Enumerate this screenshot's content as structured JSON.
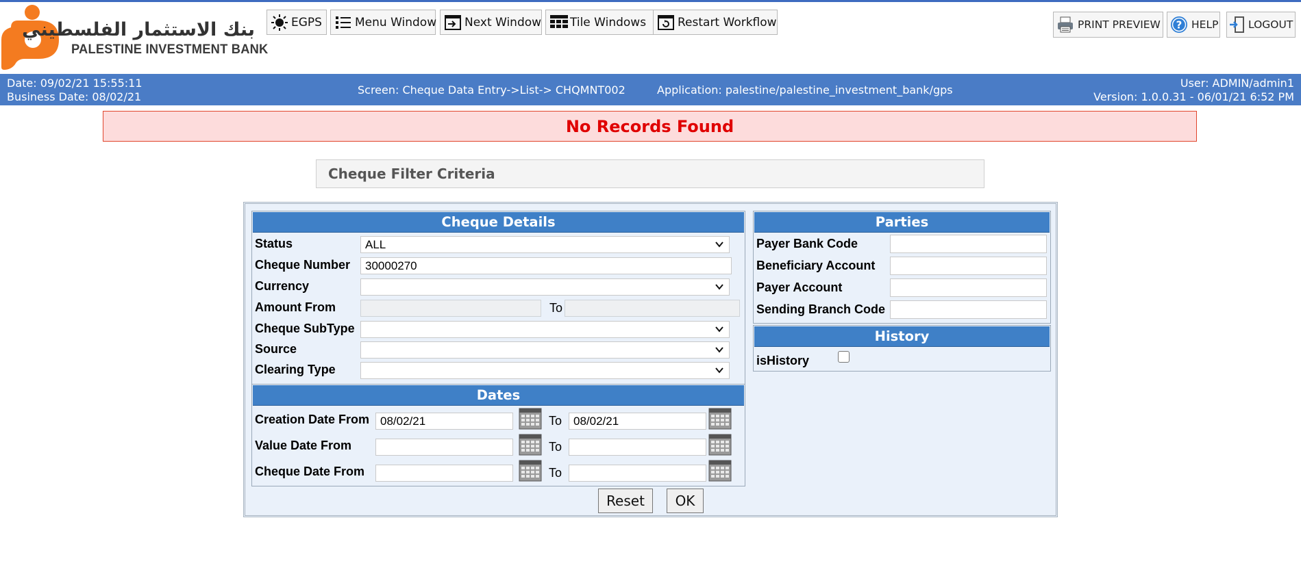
{
  "logo": {
    "arabic_name": "بنك الاستثمار الفلسطيني",
    "english_name": "PALESTINE INVESTMENT BANK",
    "brand_color": "#f47b20"
  },
  "toolbar": {
    "egps": "EGPS",
    "menu_window": "Menu Window",
    "next_window": "Next Window",
    "tile_windows": "Tile Windows",
    "restart_workflow": "Restart Workflow",
    "print_preview": "PRINT PREVIEW",
    "help": "HELP",
    "logout": "LOGOUT"
  },
  "status": {
    "date": "Date: 09/02/21 15:55:11",
    "business_date": "Business Date: 08/02/21",
    "screen": "Screen: Cheque Data Entry->List-> CHQMNT002",
    "application": "Application: palestine/palestine_investment_bank/gps",
    "user": "User: ADMIN/admin1",
    "version": "Version: 1.0.0.31 - 06/01/21 6:52 PM",
    "bar_color": "#4a7cc6"
  },
  "message": {
    "text": "No Records Found",
    "color": "#e00000"
  },
  "filter": {
    "title": "Cheque Filter Criteria"
  },
  "cheque_details": {
    "title": "Cheque Details",
    "status_label": "Status",
    "status_value": "ALL",
    "cheque_number_label": "Cheque Number",
    "cheque_number_value": "30000270",
    "currency_label": "Currency",
    "currency_value": "",
    "amount_from_label": "Amount From",
    "amount_to_label": "To",
    "amount_from_value": "",
    "amount_to_value": "",
    "subtype_label": "Cheque SubType",
    "subtype_value": "",
    "source_label": "Source",
    "source_value": "",
    "clearing_label": "Clearing Type",
    "clearing_value": ""
  },
  "dates": {
    "title": "Dates",
    "creation_label": "Creation Date From",
    "creation_from": "08/02/21",
    "creation_to": "08/02/21",
    "value_label": "Value Date From",
    "value_from": "",
    "value_to": "",
    "cheque_label": "Cheque Date From",
    "cheque_from": "",
    "cheque_to": "",
    "to_label": "To"
  },
  "parties": {
    "title": "Parties",
    "payer_bank_code_label": "Payer Bank Code",
    "payer_bank_code_value": "",
    "beneficiary_account_label": "Beneficiary Account",
    "beneficiary_account_value": "",
    "payer_account_label": "Payer Account",
    "payer_account_value": "",
    "sending_branch_code_label": "Sending Branch Code",
    "sending_branch_code_value": ""
  },
  "history": {
    "title": "History",
    "is_history_label": "isHistory",
    "is_history_checked": false
  },
  "actions": {
    "reset": "Reset",
    "ok": "OK"
  },
  "panel_header_color": "#3f80c7"
}
